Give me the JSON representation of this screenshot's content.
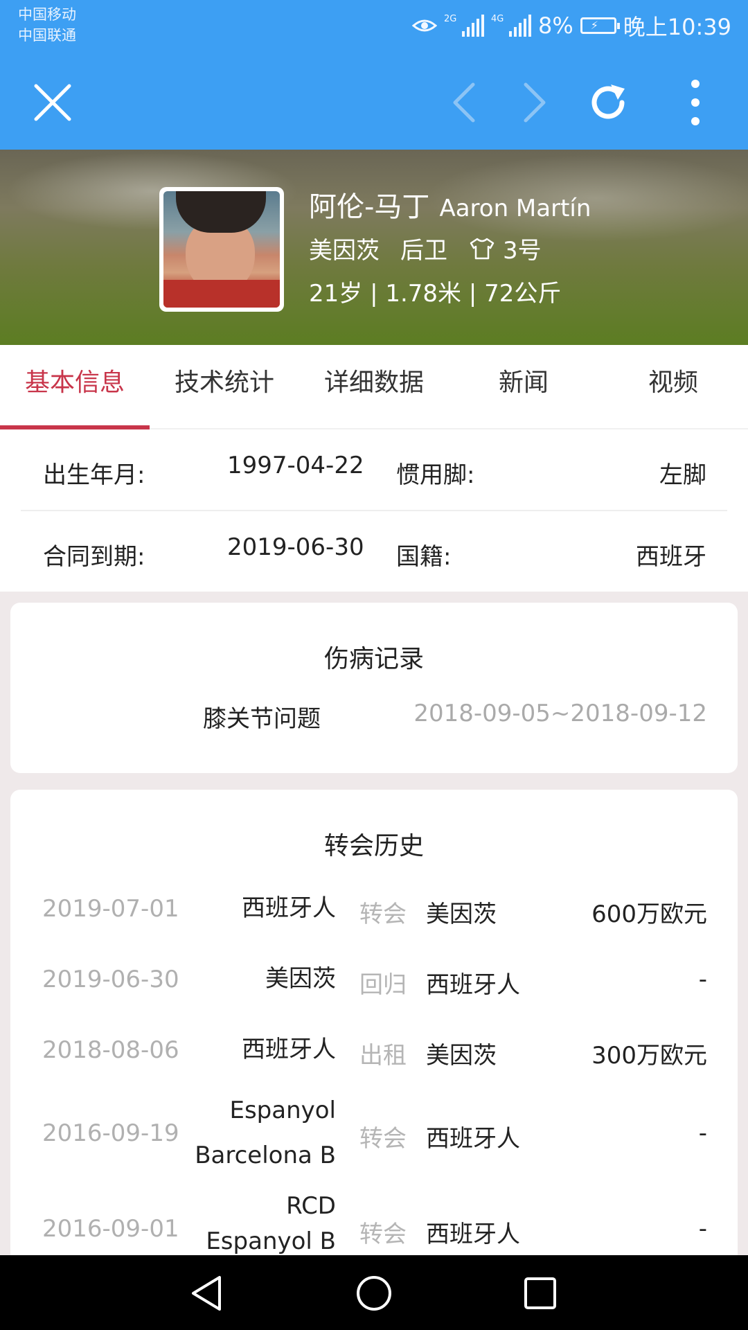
{
  "status_bar": {
    "carrier_1": "中国移动",
    "carrier_2": "中国联通",
    "net_1": "2G",
    "net_2": "4G",
    "battery": "8%",
    "time": "晚上10:39"
  },
  "toolbar": {
    "close_icon": "close-icon",
    "back_icon": "chevron-left-icon",
    "forward_icon": "chevron-right-icon",
    "refresh_icon": "refresh-icon",
    "menu_icon": "more-vertical-icon",
    "background": "#3d9ff3"
  },
  "player": {
    "name_cn": "阿伦-马丁",
    "name_en": "Aaron Martín",
    "club": "美因茨",
    "position": "后卫",
    "number": "3号",
    "body": "21岁 | 1.78米 | 72公斤"
  },
  "tabs": [
    {
      "label": "基本信息",
      "active": true
    },
    {
      "label": "技术统计",
      "active": false
    },
    {
      "label": "详细数据",
      "active": false
    },
    {
      "label": "新闻",
      "active": false
    },
    {
      "label": "视频",
      "active": false
    }
  ],
  "accent_color": "#c8354a",
  "basic_info": {
    "birth_label": "出生年月:",
    "birth_value": "1997-04-22",
    "foot_label": "惯用脚:",
    "foot_value": "左脚",
    "contract_label": "合同到期:",
    "contract_value": "2019-06-30",
    "nation_label": "国籍:",
    "nation_value": "西班牙"
  },
  "injury": {
    "title": "伤病记录",
    "items": [
      {
        "name": "膝关节问题",
        "period": "2018-09-05~2018-09-12"
      }
    ]
  },
  "transfers": {
    "title": "转会历史",
    "rows": [
      {
        "date": "2019-07-01",
        "from": "西班牙人",
        "from_2": "",
        "type": "转会",
        "to": "美因茨",
        "fee": "600万欧元"
      },
      {
        "date": "2019-06-30",
        "from": "美因茨",
        "from_2": "",
        "type": "回归",
        "to": "西班牙人",
        "fee": "-"
      },
      {
        "date": "2018-08-06",
        "from": "西班牙人",
        "from_2": "",
        "type": "出租",
        "to": "美因茨",
        "fee": "300万欧元"
      },
      {
        "date": "2016-09-19",
        "from": "Espanyol",
        "from_2": "Barcelona B",
        "type": "转会",
        "to": "西班牙人",
        "fee": "-"
      },
      {
        "date": "2016-09-01",
        "from": "RCD",
        "from_2": "Espanyol B",
        "type": "转会",
        "to": "西班牙人",
        "fee": "-"
      }
    ]
  },
  "nav_bar": {
    "back_icon": "triangle-back-icon",
    "home_icon": "circle-home-icon",
    "recents_icon": "square-recents-icon"
  }
}
